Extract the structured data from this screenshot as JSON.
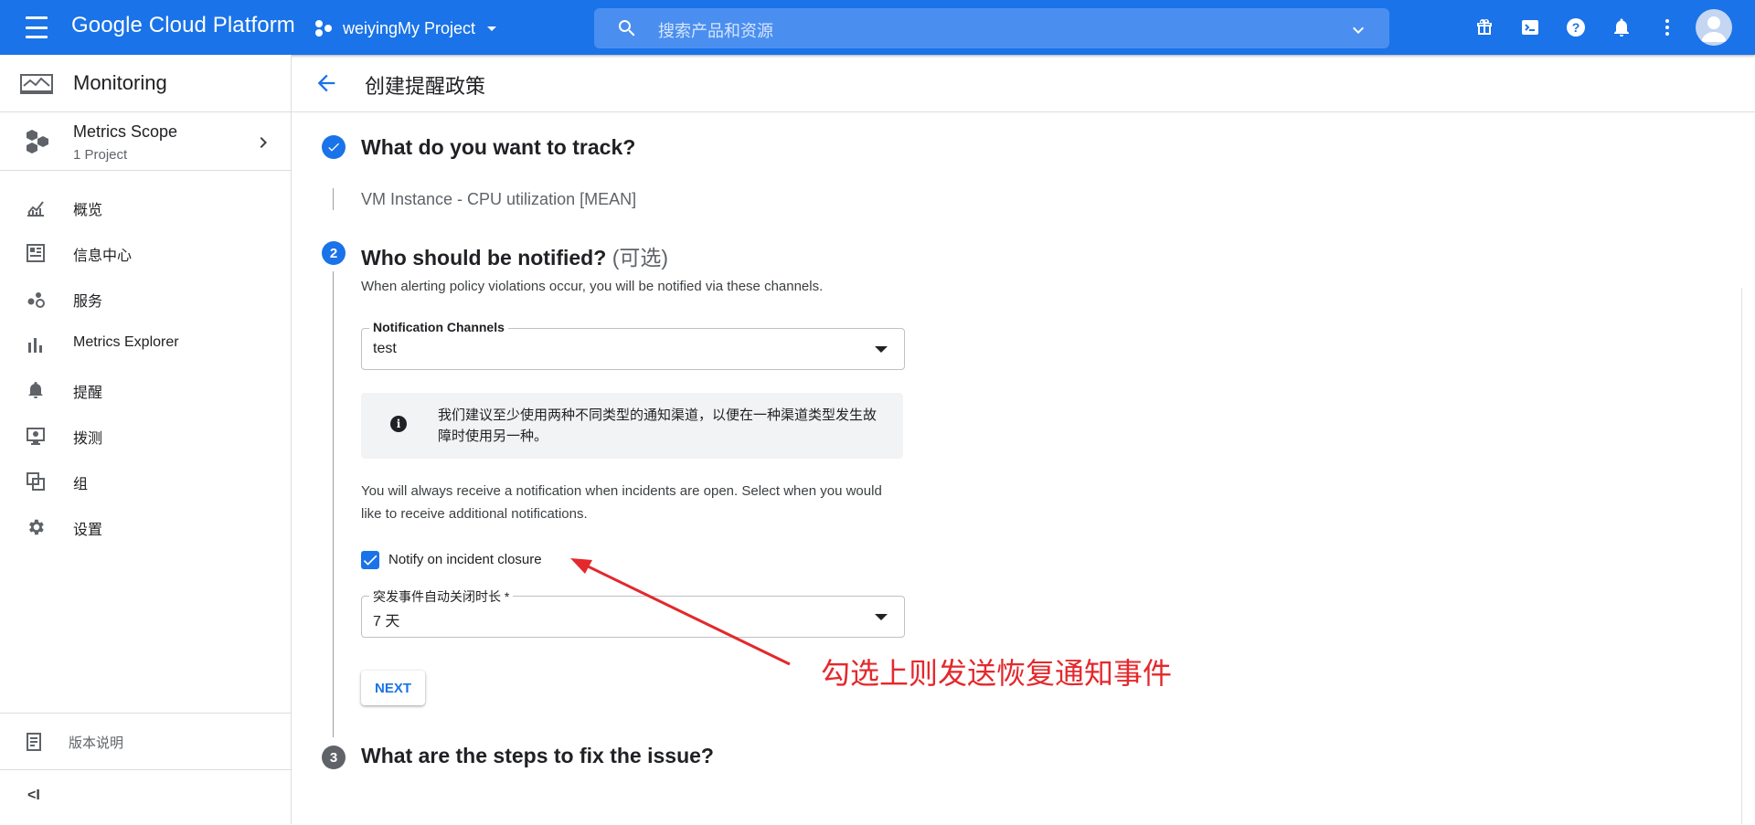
{
  "topbar": {
    "brand": "Google Cloud Platform",
    "project": "weiyingMy Project",
    "search_placeholder": "搜索产品和资源",
    "colors": {
      "bar": "#1a73e8"
    },
    "icons": [
      "gift-icon",
      "cloud-shell-icon",
      "help-icon",
      "notifications-icon",
      "more-vert-icon",
      "account-avatar"
    ]
  },
  "sidebar": {
    "product": "Monitoring",
    "scope": {
      "title": "Metrics Scope",
      "subtitle": "1 Project"
    },
    "items": [
      {
        "label": "概览",
        "icon": "chart-icon"
      },
      {
        "label": "信息中心",
        "icon": "dashboard-icon"
      },
      {
        "label": "服务",
        "icon": "services-icon"
      },
      {
        "label": "Metrics Explorer",
        "icon": "bar-chart-icon"
      },
      {
        "label": "提醒",
        "icon": "bell-icon"
      },
      {
        "label": "拨测",
        "icon": "monitor-icon"
      },
      {
        "label": "组",
        "icon": "groups-icon"
      },
      {
        "label": "设置",
        "icon": "gear-icon"
      }
    ],
    "release_notes": "版本说明",
    "collapse_label": "<I"
  },
  "page": {
    "title": "创建提醒政策"
  },
  "steps": {
    "step1": {
      "title": "What do you want to track?",
      "summary": "VM Instance - CPU utilization [MEAN]"
    },
    "step2": {
      "number": "2",
      "title": "Who should be notified?",
      "optional": "(可选)",
      "description": "When alerting policy violations occur, you will be notified via these channels.",
      "channels_label": "Notification Channels",
      "channels_value": "test",
      "info_text": "我们建议至少使用两种不同类型的通知渠道，以便在一种渠道类型发生故障时使用另一种。",
      "incidents_text": "You will always receive a notification when incidents are open. Select when you would like to receive additional notifications.",
      "checkbox_label": "Notify on incident closure",
      "checkbox_checked": true,
      "autoclose_label": "突发事件自动关闭时长 *",
      "autoclose_value": "7 天",
      "next_label": "NEXT"
    },
    "step3": {
      "number": "3",
      "title": "What are the steps to fix the issue?"
    }
  },
  "annotation": {
    "text": "勾选上则发送恢复通知事件",
    "color": "#e4282c"
  }
}
